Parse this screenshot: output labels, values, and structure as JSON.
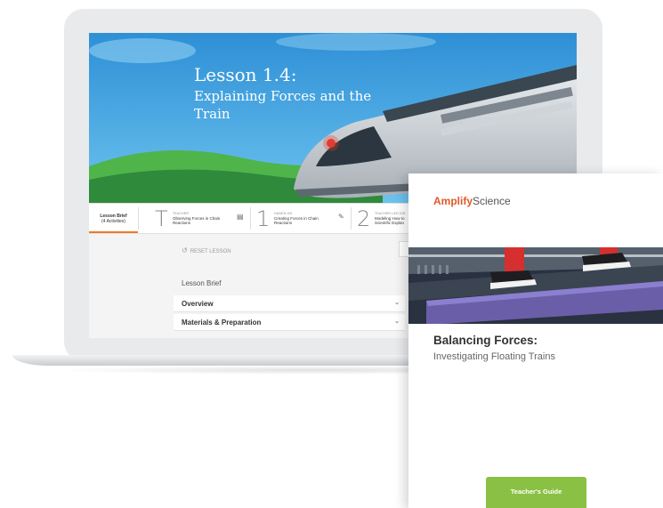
{
  "lesson": {
    "title": "Lesson 1.4:",
    "subtitle": "Explaining Forces and the Train"
  },
  "nav": {
    "brief_title": "Lesson Brief",
    "brief_sub": "(4 Activities)",
    "activities": [
      {
        "letter": "T",
        "kind": "TEACHER",
        "title": "Observing Forces in Chain Reactions"
      },
      {
        "letter": "1",
        "kind": "HANDS-ON",
        "title": "Creating Forces in Chain Reactions"
      },
      {
        "letter": "2",
        "kind": "TEACHER-LED DIS",
        "title": "Modeling How to Scientific Explan"
      }
    ]
  },
  "content": {
    "reset_label": "RESET LESSON",
    "section_label": "Lesson Brief",
    "accordion": [
      {
        "label": "Overview"
      },
      {
        "label": "Materials & Preparation"
      }
    ]
  },
  "book": {
    "brand_a": "Amplify",
    "brand_b": "Science",
    "title": "Balancing Forces:",
    "subtitle": "Investigating Floating Trains",
    "guide_label": "Teacher's Guide"
  },
  "colors": {
    "brand_orange": "#e2582a",
    "guide_green": "#8ac044",
    "sky_blue": "#3fa4e0",
    "hill_green": "#3aa044"
  }
}
